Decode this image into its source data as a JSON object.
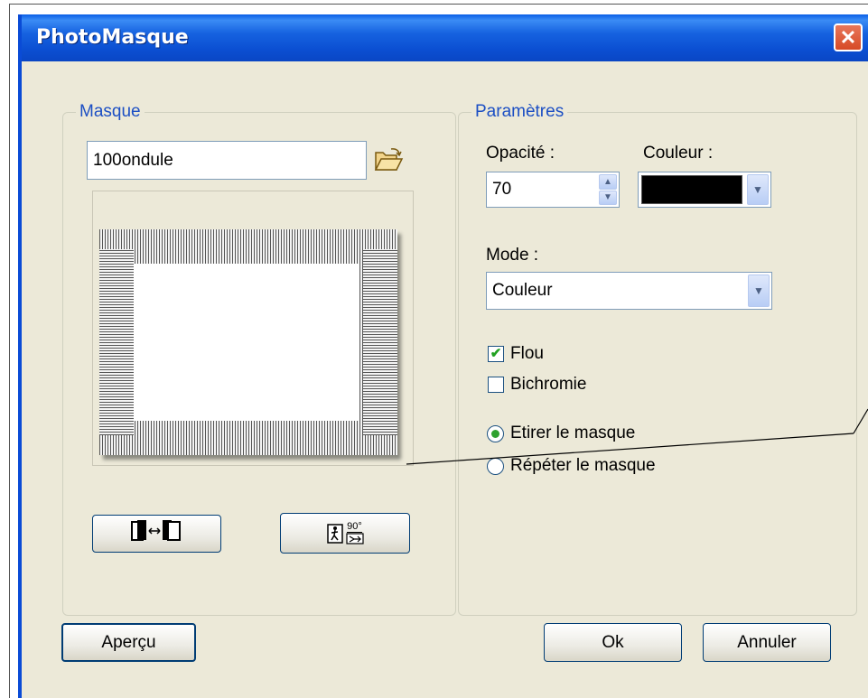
{
  "window": {
    "title": "PhotoMasque",
    "close_symbol": "✕"
  },
  "masque_group": {
    "label": "Masque",
    "file_value": "100ondule",
    "open_icon": "folder-open-icon",
    "swap_button_icon": "swap-sides-icon",
    "rotate_button_icon": "rotate-90-icon",
    "rotate_label": "90°"
  },
  "params_group": {
    "label": "Paramètres",
    "opacity_label": "Opacité :",
    "opacity_value": "70",
    "color_label": "Couleur :",
    "color_value": "#000000",
    "mode_label": "Mode :",
    "mode_value": "Couleur",
    "flou_label": "Flou",
    "flou_checked": true,
    "bichromie_label": "Bichromie",
    "bichromie_checked": false,
    "etirer_label": "Etirer le masque",
    "repeter_label": "Répéter le masque",
    "selected_option": "etirer"
  },
  "buttons": {
    "apercu": "Aperçu",
    "ok": "Ok",
    "annuler": "Annuler"
  },
  "colors": {
    "title_bar": "#0b4fd2",
    "dialog_bg": "#ece9d8",
    "group_label": "#1c4fc4",
    "close_button": "#d64a26"
  }
}
